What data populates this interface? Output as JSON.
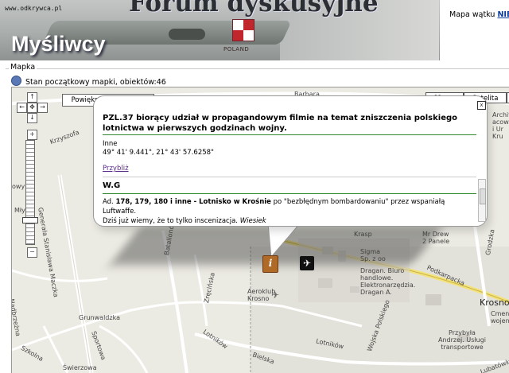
{
  "header": {
    "site_url": "www.odkrywca.pl",
    "forum_title": "Forum dyskusyjne",
    "section_title": "Myśliwcy",
    "roundel_text": "POLAND",
    "topic_map_prefix": "Mapa wątku",
    "topic_map_link": "NIEU"
  },
  "map_section": {
    "legend": "Mapka",
    "status": "Stan początkowy mapki, obiektów:46"
  },
  "map": {
    "enlarge_button": "Powiększenie obszaru",
    "map_types": [
      "Mapa",
      "Satelita",
      ""
    ],
    "active_type": "Mapa",
    "labels": {
      "barbara": "Barbara",
      "krzyszofa": "Krzyszofa",
      "ow": "owy",
      "mlyn": "Młyn",
      "gen": "Generała Stanisława Maczka",
      "bat": "Batalionów Chłopskich",
      "zrem": "Zręcińska",
      "aero": "Aeroklub\nKrosno",
      "lot1": "Lotników",
      "lot2": "Lotników",
      "krasp": "Krasp",
      "grun": "Grunwaldzka",
      "szkolna": "Szkolna",
      "sportowa": "Sportowa",
      "nad": "Nadbrzeżna",
      "swierzowa": "Świerzowa",
      "sigma": "Sigma\nSp. z oo",
      "dragan": "Dragan. Biuro\nhandlowe.\nElektronarzędzia.\nDragan A.",
      "mrdrew": "Mr Drew\n2 Panele",
      "podk": "Podkarpacka",
      "krosno": "Krosno",
      "cment": "Cmenta\nwojenn",
      "przyb": "Przybyła\nAndrzej. Usługi\ntransportowe",
      "lubat": "Lubatówka",
      "archi": "Archito\nacown\ni Ur\nKru",
      "grodzka": "Grodzka",
      "bielska": "Bielska",
      "wojska": "Wojska Polskiego"
    },
    "popup": {
      "close": "x",
      "title": "PZL.37 biorący udział w propagandowym filmie na temat zniszczenia polskiego lotnictwa w pierwszych godzinach wojny.",
      "category": "Inne",
      "coords": "49° 41' 9.441\", 21° 43' 57.6258\"",
      "zoom_link": "Przybliż",
      "author": "W.G",
      "body_parts": {
        "p1": "Ad. ",
        "p2": "178, 179, 180 i inne - Lotnisko w Krośnie",
        "p3": " po \"bezbłędnym bombardowaniu\" przez wspaniałą Luftwaffe.",
        "p4": "Dziś już wiemy, że to tylko inscenizacja. ",
        "p5": "Wiesiek"
      }
    },
    "markers": {
      "info": "i",
      "plane": "✈"
    }
  }
}
